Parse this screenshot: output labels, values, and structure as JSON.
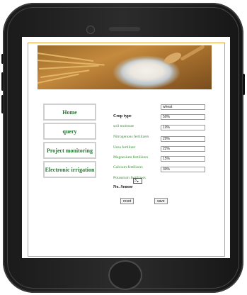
{
  "nav": {
    "items": [
      {
        "label": "Home"
      },
      {
        "label": "query"
      },
      {
        "label": "Project monitoring"
      },
      {
        "label": "Electronic irrigation"
      }
    ]
  },
  "form": {
    "crop_type": {
      "label": "Crop type",
      "value": "wheat"
    },
    "soil_moisture": {
      "label": "soil moisture",
      "value": "50%"
    },
    "nitrogenous": {
      "label": "Nitrogenous fertilizers",
      "value": "10%"
    },
    "urea": {
      "label": "Urea fertilizer",
      "value": "20%"
    },
    "magnesium": {
      "label": "Magnesium fertilizers",
      "value": "22%"
    },
    "calcium": {
      "label": "Calcium fertilizers",
      "value": "15%"
    },
    "potassium": {
      "label": "Potassium fertilizers",
      "value": "30%"
    },
    "sensor": {
      "label": "No. Sensor",
      "value": "3"
    }
  },
  "actions": {
    "reset_label": "reset",
    "save_label": "save"
  },
  "colors": {
    "nav_text": "#1d7a2c",
    "label_text": "#3a8a3a",
    "frame_border": "#e0a23a"
  }
}
